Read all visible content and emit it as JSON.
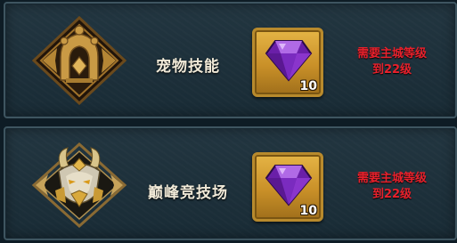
{
  "features": [
    {
      "title": "宠物技能",
      "icon": "pet-skill-emblem-icon",
      "reward": {
        "icon": "purple-gem-icon",
        "count": "10"
      },
      "requirement_line1": "需要主城等级",
      "requirement_line2": "到22级"
    },
    {
      "title": "巅峰竞技场",
      "icon": "arena-beast-crest-icon",
      "reward": {
        "icon": "purple-gem-icon",
        "count": "10"
      },
      "requirement_line1": "需要主城等级",
      "requirement_line2": "到22级"
    }
  ],
  "colors": {
    "card_bg": "#1b2f3a",
    "card_border": "#3e5560",
    "requirement_text": "#e8212c",
    "slot_gold": "#c99028",
    "gem_purple": "#7a2bbf"
  }
}
